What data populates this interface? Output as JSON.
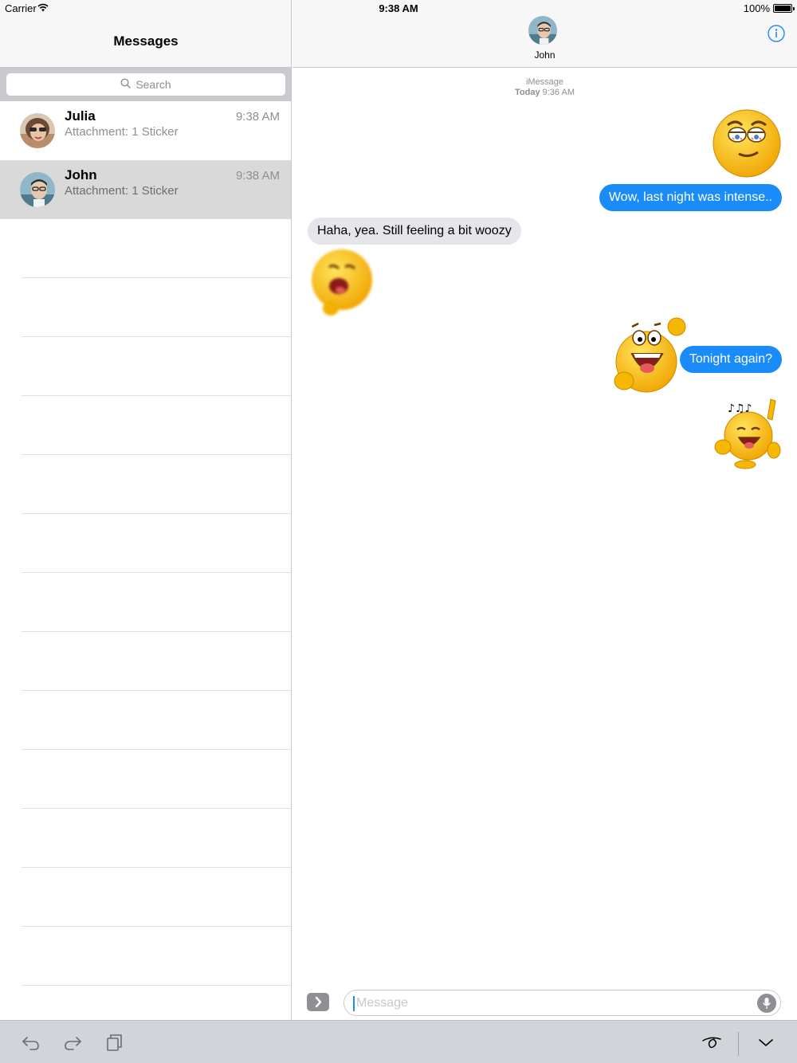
{
  "status_bar": {
    "carrier": "Carrier",
    "time": "9:38 AM",
    "battery": "100%"
  },
  "sidebar": {
    "title": "Messages",
    "search_placeholder": "Search",
    "conversations": [
      {
        "name": "Julia",
        "preview": "Attachment: 1 Sticker",
        "time": "9:38 AM"
      },
      {
        "name": "John",
        "preview": "Attachment: 1 Sticker",
        "time": "9:38 AM",
        "selected": true
      }
    ]
  },
  "chat": {
    "contact_name": "John",
    "service": "iMessage",
    "timestamp_day": "Today",
    "timestamp_time": "9:36 AM",
    "messages": [
      {
        "direction": "out",
        "type": "sticker",
        "sticker": "sleepy-emoji"
      },
      {
        "direction": "out",
        "type": "text",
        "text": "Wow, last night was intense.."
      },
      {
        "direction": "in",
        "type": "text",
        "text": "Haha, yea. Still feeling a bit woozy"
      },
      {
        "direction": "in",
        "type": "sticker",
        "sticker": "dizzy-emoji"
      },
      {
        "direction": "out",
        "type": "sticker",
        "sticker": "excited-waving-emoji"
      },
      {
        "direction": "out",
        "type": "text",
        "text": "Tonight again?"
      },
      {
        "direction": "out",
        "type": "sticker",
        "sticker": "singing-emoji"
      }
    ],
    "input_placeholder": "Message"
  },
  "colors": {
    "outgoing_bubble": "#1a8cf9",
    "incoming_bubble": "#e5e5ea",
    "accent": "#1a8cf9"
  },
  "icons": [
    "wifi-icon",
    "battery-icon",
    "search-icon",
    "info-icon",
    "chevron-right-icon",
    "microphone-icon",
    "undo-icon",
    "redo-icon",
    "paste-icon",
    "handwriting-icon",
    "dismiss-keyboard-icon"
  ]
}
